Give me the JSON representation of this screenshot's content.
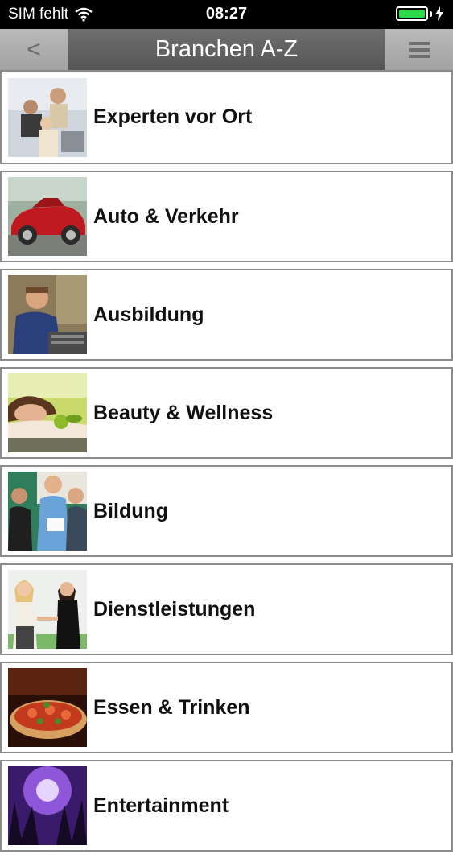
{
  "status": {
    "carrier": "SIM fehlt",
    "time": "08:27",
    "battery_color": "#2bd94a"
  },
  "nav": {
    "back_label": "<",
    "title": "Branchen A-Z",
    "menu_icon": "hamburger-icon"
  },
  "items": [
    {
      "label": "Experten vor Ort"
    },
    {
      "label": "Auto & Verkehr"
    },
    {
      "label": "Ausbildung"
    },
    {
      "label": "Beauty & Wellness"
    },
    {
      "label": "Bildung"
    },
    {
      "label": "Dienstleistungen"
    },
    {
      "label": "Essen & Trinken"
    },
    {
      "label": "Entertainment"
    }
  ]
}
